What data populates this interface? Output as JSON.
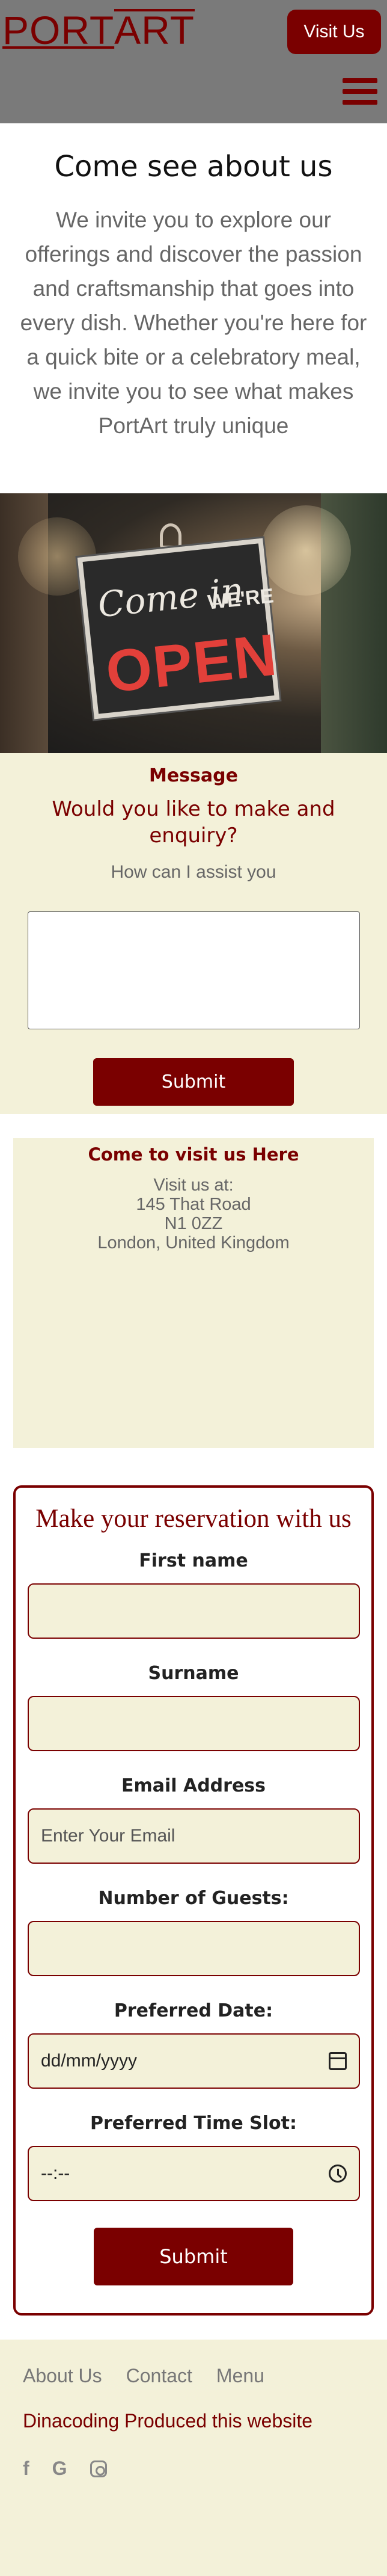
{
  "header": {
    "logo_part": "PORT",
    "logo_art": "ART",
    "visit_button": "Visit Us",
    "menu_icon": "hamburger-menu-icon"
  },
  "about": {
    "title": "Come see about us",
    "body": "We invite you to explore our offerings and discover the passion and craftsmanship that goes into every dish. Whether you're here for a quick bite or a celebratory meal, we invite you to see what makes PortArt truly unique"
  },
  "hero": {
    "sign_line1": "Come in",
    "sign_line2": "WE'RE",
    "sign_line3": "OPEN"
  },
  "message": {
    "label": "Message",
    "question": "Would you like to make and enquiry?",
    "hint": "How can I assist you",
    "submit": "Submit"
  },
  "visit": {
    "title": "Come to visit us Here",
    "line1": "Visit us at:",
    "line2": "145 That Road",
    "line3": "N1 0ZZ",
    "line4": "London, United Kingdom"
  },
  "reservation": {
    "title": "Make your reservation with us",
    "first_name_label": "First name",
    "surname_label": "Surname",
    "email_label": "Email Address",
    "email_placeholder": "Enter Your Email",
    "guests_label": "Number of Guests:",
    "date_label": "Preferred Date:",
    "date_placeholder": "dd/mm/yyyy",
    "time_label": "Preferred Time Slot:",
    "time_placeholder": "--:--",
    "submit": "Submit"
  },
  "footer": {
    "links": [
      "About Us",
      "Contact",
      "Menu"
    ],
    "credit": "Dinacoding Produced this website",
    "socials": [
      "facebook-icon",
      "google-icon",
      "instagram-icon"
    ]
  },
  "colors": {
    "brand": "#7a0000",
    "cream": "#f3f1d9",
    "header_bg": "#7a7a7a"
  }
}
